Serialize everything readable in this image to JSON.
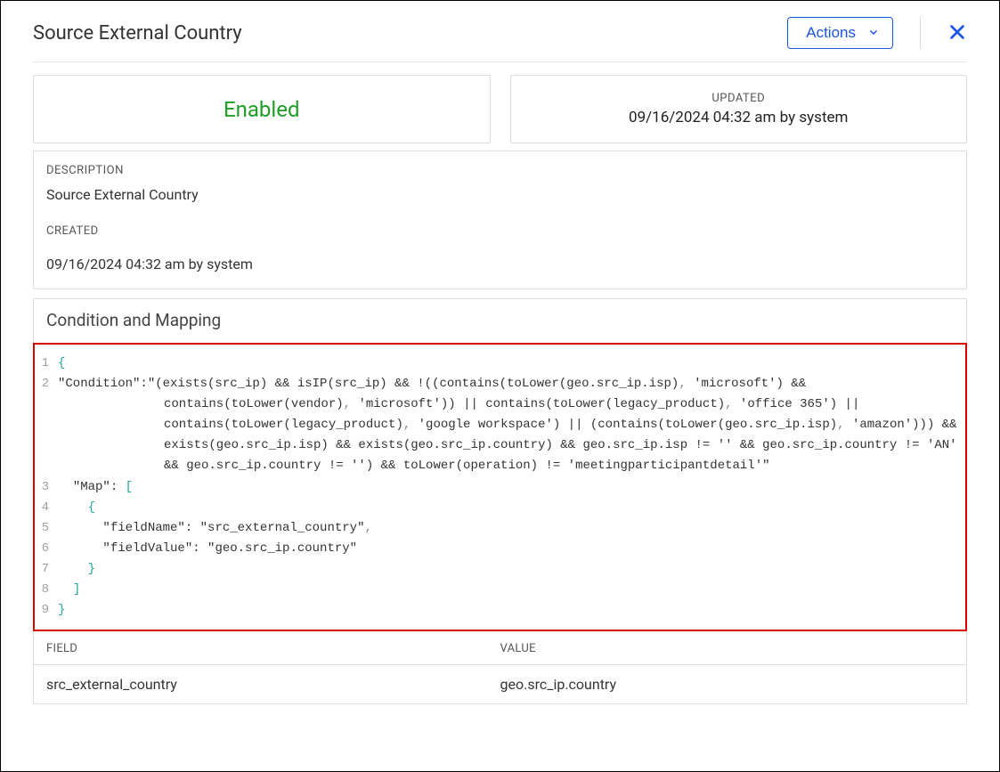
{
  "header": {
    "title": "Source External Country",
    "actions_label": "Actions"
  },
  "status": {
    "enabled_label": "Enabled",
    "updated_label": "UPDATED",
    "updated_value": "09/16/2024 04:32 am by system"
  },
  "description": {
    "label": "DESCRIPTION",
    "value": "Source External Country",
    "created_label": "CREATED",
    "created_value": "09/16/2024 04:32 am by system"
  },
  "condition": {
    "heading": "Condition and Mapping",
    "code_lines": [
      "{",
      "\"Condition\":\"(exists(src_ip) && isIP(src_ip) && !((contains(toLower(geo.src_ip.isp), 'microsoft') && contains(toLower(vendor), 'microsoft')) || contains(toLower(legacy_product), 'office 365') || contains(toLower(legacy_product), 'google workspace') || (contains(toLower(geo.src_ip.isp), 'amazon'))) && exists(geo.src_ip.isp) && exists(geo.src_ip.country) && geo.src_ip.isp != '' && geo.src_ip.country != 'AN' && geo.src_ip.country != '') && toLower(operation) != 'meetingparticipantdetail'\"",
      "  \"Map\": [",
      "    {",
      "      \"fieldName\": \"src_external_country\",",
      "      \"fieldValue\": \"geo.src_ip.country\"",
      "    }",
      "  ]",
      "}"
    ]
  },
  "table": {
    "field_label": "FIELD",
    "value_label": "VALUE",
    "rows": [
      {
        "field": "src_external_country",
        "value": "geo.src_ip.country"
      }
    ]
  }
}
